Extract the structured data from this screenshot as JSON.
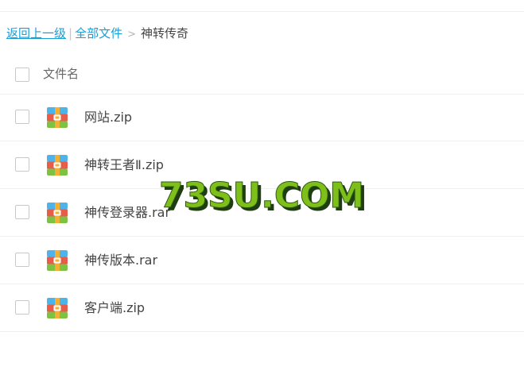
{
  "breadcrumb": {
    "back_label": "返回上一级",
    "separator": "|",
    "all_files_label": "全部文件",
    "arrow": ">",
    "current_folder": "神转传奇"
  },
  "list_header": {
    "name_column": "文件名"
  },
  "files": [
    {
      "name": "网站.zip",
      "icon": "archive-icon"
    },
    {
      "name": "神转王者Ⅱ.zip",
      "icon": "archive-icon"
    },
    {
      "name": "神传登录器.rar",
      "icon": "archive-icon"
    },
    {
      "name": "神传版本.rar",
      "icon": "archive-icon"
    },
    {
      "name": "客户端.zip",
      "icon": "archive-icon"
    }
  ],
  "watermark": {
    "text": "73SU.COM",
    "fill_color": "#7fbf1a",
    "shadow_color": "#1f3d12"
  },
  "colors": {
    "link": "#1a9ed6",
    "text": "#444444",
    "icon_blue": "#4db3e8",
    "icon_red": "#e85d4a",
    "icon_green": "#7dc242",
    "icon_band": "#f2b134"
  }
}
